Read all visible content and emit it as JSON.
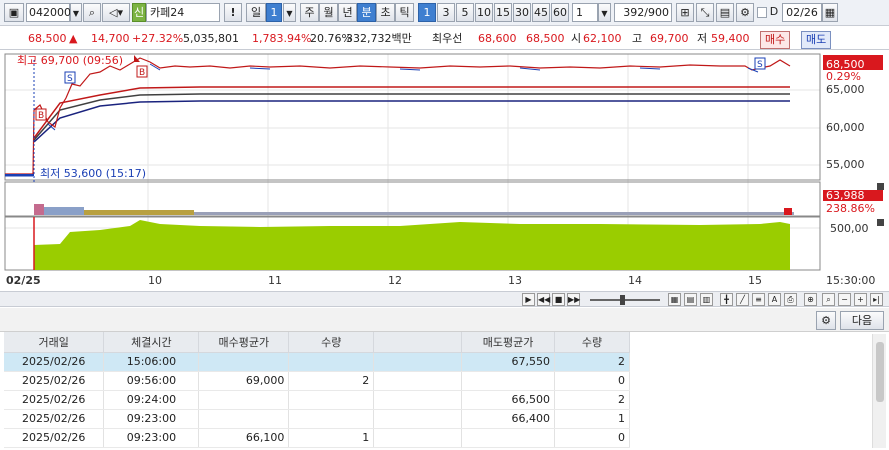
{
  "toolbar": {
    "code": "042000",
    "stock_tag": "신",
    "stock_name": "카페24",
    "alert": "!",
    "day_label": "일",
    "day_value": "1",
    "period_week": "주",
    "period_month": "월",
    "period_year": "년",
    "period_minute": "분",
    "period_second": "초",
    "period_tick": "틱",
    "interval_buttons": [
      "1",
      "3",
      "5",
      "10",
      "15",
      "30",
      "45",
      "60"
    ],
    "interval_input": "1",
    "count": "392",
    "count_total": "/900",
    "date": "02/26",
    "date_prefix": "D"
  },
  "pricebar": {
    "price": "68,500",
    "change_sign": "▲",
    "change": "14,700",
    "change_pct": "+27.32%",
    "volume": "5,035,801",
    "volume_ratio": "1,783.94%",
    "turnover": "20.76%",
    "amount": "332,732백만",
    "best_label": "최우선",
    "best_ask": "68,600",
    "best_bid": "68,500",
    "open_label": "시",
    "open": "62,100",
    "high_label": "고",
    "high": "69,700",
    "low_label": "저",
    "low": "59,400",
    "buy_button": "매수",
    "sell_button": "매도"
  },
  "chart": {
    "high_marker": "최고 69,700 (09:56)",
    "low_marker": "최저 53,600 (15:17)",
    "price_axis": [
      "65,000",
      "60,000",
      "55,000"
    ],
    "current_price_tag": "68,500",
    "current_change_tag": "0.29%",
    "indicator_tag": "63,988",
    "indicator_pct_tag": "238.86%",
    "volume_axis": [
      "500,00"
    ],
    "date_start": "02/25",
    "time_labels": [
      "10",
      "11",
      "12",
      "13",
      "14",
      "15"
    ],
    "time_end": "15:30:00",
    "colors": {
      "up": "#d9181e",
      "down": "#1a3fb4",
      "volume": "#9acd00"
    }
  },
  "lower": {
    "next_button": "다음"
  },
  "table": {
    "headers": [
      "거래일",
      "체결시간",
      "매수평균가",
      "수량",
      "",
      "매도평균가",
      "수량"
    ],
    "rows": [
      [
        "2025/02/26",
        "15:06:00",
        "",
        "",
        "",
        "67,550",
        "2"
      ],
      [
        "2025/02/26",
        "09:56:00",
        "69,000",
        "2",
        "",
        "",
        "0"
      ],
      [
        "2025/02/26",
        "09:24:00",
        "",
        "",
        "",
        "66,500",
        "2"
      ],
      [
        "2025/02/26",
        "09:23:00",
        "",
        "",
        "",
        "66,400",
        "1"
      ],
      [
        "2025/02/26",
        "09:23:00",
        "66,100",
        "1",
        "",
        "",
        "0"
      ]
    ]
  }
}
